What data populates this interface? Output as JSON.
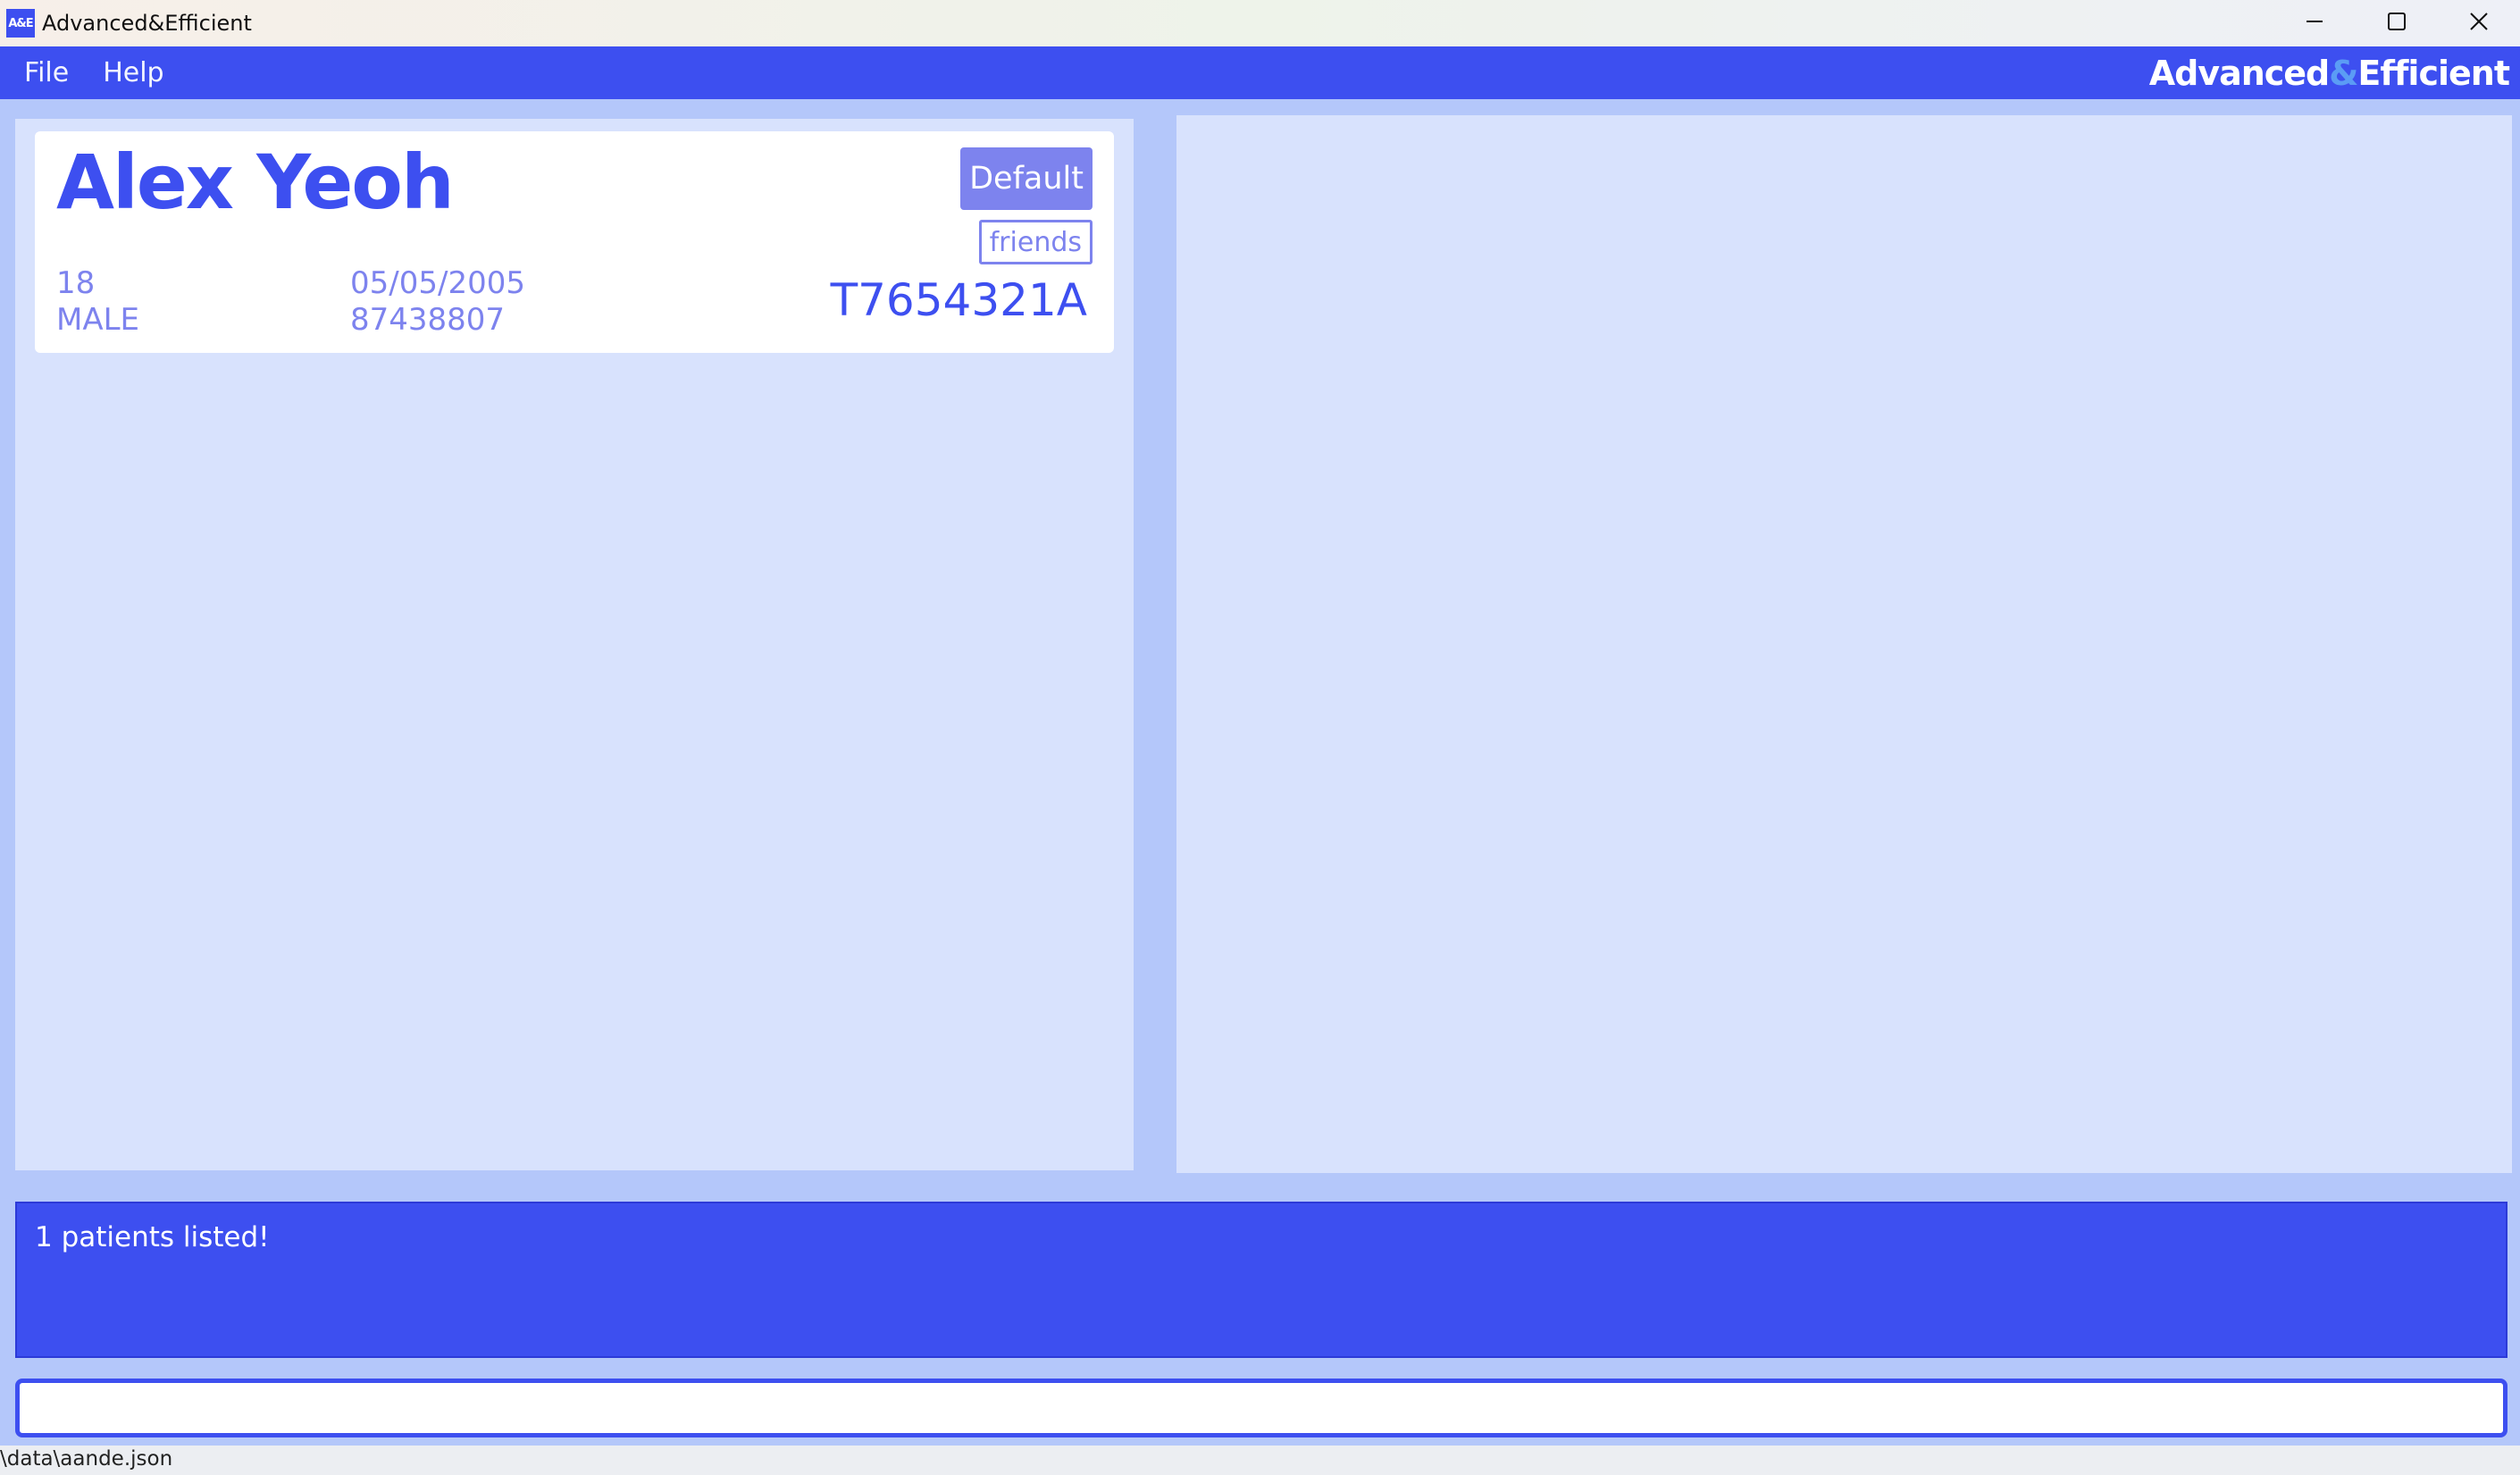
{
  "window": {
    "title": "Advanced&Efficient",
    "icon_text": "A&E"
  },
  "menu": {
    "items": [
      "File",
      "Help"
    ],
    "brand_prefix": "Advanced",
    "brand_amp": "&",
    "brand_suffix": "Efficient"
  },
  "patients": [
    {
      "name": "Alex Yeoh",
      "age": "18",
      "sex": "MALE",
      "dob": "05/05/2005",
      "phone": "87438807",
      "nric": "T7654321A",
      "priority": "Default",
      "tags": [
        "friends"
      ]
    }
  ],
  "result": {
    "message": "1 patients listed!"
  },
  "command": {
    "value": "",
    "placeholder": ""
  },
  "status": {
    "path": "\\data\\aande.json"
  },
  "colors": {
    "primary": "#3d4ff0",
    "panel": "#d8e2fd",
    "muted": "#7d83ee",
    "background": "#b4c7fa"
  }
}
